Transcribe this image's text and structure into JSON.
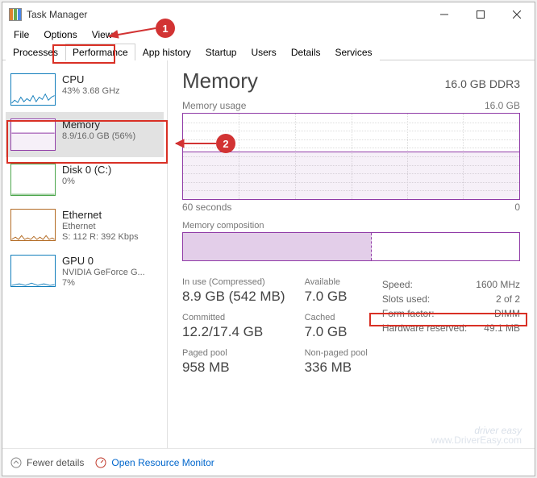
{
  "window": {
    "title": "Task Manager"
  },
  "menubar": [
    "File",
    "Options",
    "View"
  ],
  "tabs": [
    "Processes",
    "Performance",
    "App history",
    "Startup",
    "Users",
    "Details",
    "Services"
  ],
  "active_tab": "Performance",
  "sidebar": [
    {
      "title": "CPU",
      "sub": "43% 3.68 GHz",
      "border": "#117dbb",
      "stroke": "#117dbb"
    },
    {
      "title": "Memory",
      "sub": "8.9/16.0 GB (56%)",
      "border": "#903ba7",
      "stroke": "#903ba7",
      "selected": true
    },
    {
      "title": "Disk 0 (C:)",
      "sub": "0%",
      "border": "#4ca64c",
      "stroke": "#4ca64c"
    },
    {
      "title": "Ethernet",
      "sub": "Ethernet",
      "sub2": "S: 112 R: 392 Kbps",
      "border": "#b36b24",
      "stroke": "#b36b24"
    },
    {
      "title": "GPU 0",
      "sub": "NVIDIA GeForce G...",
      "sub2": "7%",
      "border": "#117dbb",
      "stroke": "#117dbb"
    }
  ],
  "main": {
    "title": "Memory",
    "spec": "16.0 GB DDR3",
    "usage_label": "Memory usage",
    "usage_max": "16.0 GB",
    "time_label": "60 seconds",
    "time_end": "0",
    "composition_label": "Memory composition"
  },
  "stats_grid": [
    {
      "label": "In use (Compressed)",
      "value": "8.9 GB (542 MB)"
    },
    {
      "label": "Available",
      "value": "7.0 GB"
    },
    {
      "label": "Committed",
      "value": "12.2/17.4 GB"
    },
    {
      "label": "Cached",
      "value": "7.0 GB"
    },
    {
      "label": "Paged pool",
      "value": "958 MB"
    },
    {
      "label": "Non-paged pool",
      "value": "336 MB"
    }
  ],
  "stats_right": [
    {
      "label": "Speed:",
      "value": "1600 MHz"
    },
    {
      "label": "Slots used:",
      "value": "2 of 2"
    },
    {
      "label": "Form factor:",
      "value": "DIMM"
    },
    {
      "label": "Hardware reserved:",
      "value": "49.1 MB"
    }
  ],
  "statusbar": {
    "fewer": "Fewer details",
    "orm": "Open Resource Monitor"
  },
  "annotations": {
    "badge1": "1",
    "badge2": "2"
  },
  "watermark": {
    "line1": "driver easy",
    "line2": "www.DriverEasy.com"
  },
  "chart_data": {
    "type": "line",
    "title": "Memory usage",
    "xlabel": "60 seconds",
    "ylabel": "",
    "ylim": [
      0,
      16.0
    ],
    "series": [
      {
        "name": "Memory (GB)",
        "values": [
          9.0,
          9.0,
          8.95,
          8.95,
          8.9,
          8.9,
          8.9,
          8.9,
          8.9,
          8.9,
          8.9,
          8.9
        ]
      }
    ]
  }
}
